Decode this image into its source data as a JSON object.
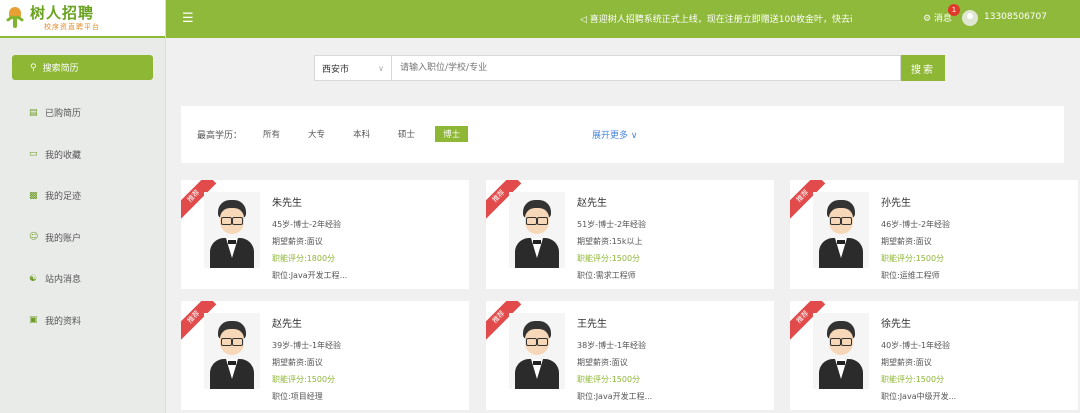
{
  "logo": {
    "title": "树人招聘",
    "subtitle": "校序资直聘平台"
  },
  "sidebar": {
    "search_label": "搜索简历",
    "items": [
      {
        "label": "已购简历",
        "icon": "resume-icon"
      },
      {
        "label": "我的收藏",
        "icon": "folder-icon"
      },
      {
        "label": "我的足迹",
        "icon": "chart-icon"
      },
      {
        "label": "我的账户",
        "icon": "user-icon"
      },
      {
        "label": "站内消息",
        "icon": "message-icon"
      },
      {
        "label": "我的资料",
        "icon": "profile-icon"
      }
    ]
  },
  "topbar": {
    "notice": "喜迎树人招聘系统正式上线，现在注册立即赠送100枚金叶，快去i",
    "message_label": "消息",
    "message_count": "1",
    "phone": "13308506707"
  },
  "search": {
    "city": "西安市",
    "placeholder": "请输入职位/学校/专业",
    "button": "搜索"
  },
  "filter": {
    "label": "最高学历：",
    "options": [
      "所有",
      "大专",
      "本科",
      "硕士",
      "博士"
    ],
    "active_index": 4,
    "expand": "展开更多"
  },
  "cards": [
    {
      "badge": "推荐",
      "name": "朱先生",
      "age_edu": "45岁-博士-2年经验",
      "salary": "期望薪资:面议",
      "score": "职能评分:1800分",
      "position": "职位:Java开发工程..."
    },
    {
      "badge": "推荐",
      "name": "赵先生",
      "age_edu": "51岁-博士-2年经验",
      "salary": "期望薪资:15k以上",
      "score": "职能评分:1500分",
      "position": "职位:需求工程师"
    },
    {
      "badge": "推荐",
      "name": "孙先生",
      "age_edu": "46岁-博士-2年经验",
      "salary": "期望薪资:面议",
      "score": "职能评分:1500分",
      "position": "职位:运维工程师"
    },
    {
      "badge": "推荐",
      "name": "赵先生",
      "age_edu": "39岁-博士-1年经验",
      "salary": "期望薪资:面议",
      "score": "职能评分:1500分",
      "position": "职位:项目经理"
    },
    {
      "badge": "推荐",
      "name": "王先生",
      "age_edu": "38岁-博士-1年经验",
      "salary": "期望薪资:面议",
      "score": "职能评分:1500分",
      "position": "职位:Java开发工程..."
    },
    {
      "badge": "推荐",
      "name": "徐先生",
      "age_edu": "40岁-博士-1年经验",
      "salary": "期望薪资:面议",
      "score": "职能评分:1500分",
      "position": "职位:Java中级开发..."
    }
  ]
}
